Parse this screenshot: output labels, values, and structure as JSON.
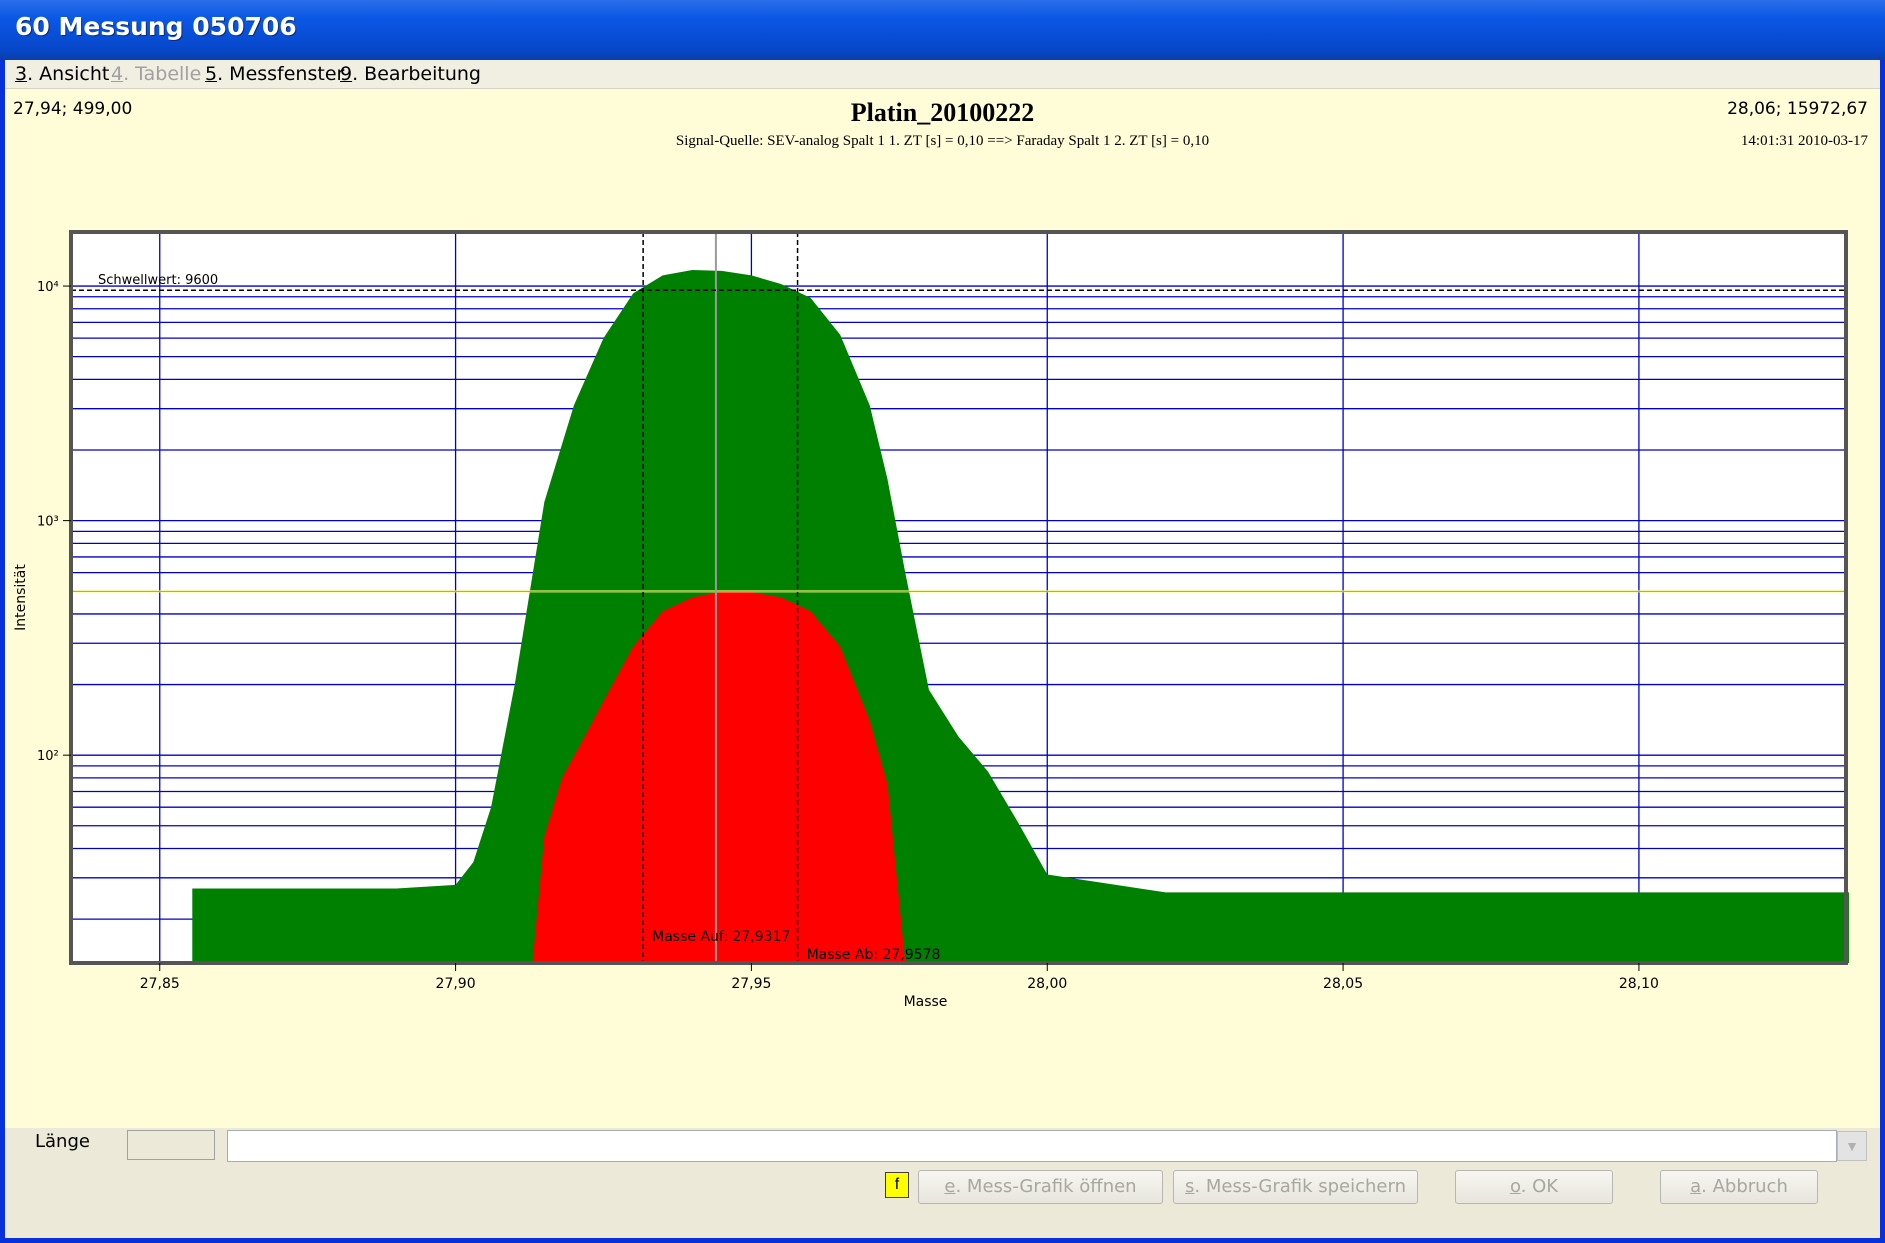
{
  "window": {
    "title": "60  Messung 050706"
  },
  "menu": [
    {
      "key": "3",
      "label": ". Ansicht",
      "disabled": false
    },
    {
      "key": "4",
      "label": ". Tabelle",
      "disabled": true
    },
    {
      "key": "5",
      "label": ". Messfenster",
      "disabled": false
    },
    {
      "key": "9",
      "label": ". Bearbeitung",
      "disabled": false
    }
  ],
  "cursor_left": "27,94; 499,00",
  "cursor_right": "28,06; 15972,67",
  "timestamp": "14:01:31 2010-03-17",
  "chart_data": {
    "type": "area",
    "title": "Platin_20100222",
    "subtitle": "Signal-Quelle: SEV-analog Spalt 1  1. ZT [s] = 0,10  ==>  Faraday Spalt 1  2. ZT [s] = 0,10",
    "xlabel": "Masse",
    "ylabel": "Intensität",
    "y_scale": "log",
    "xlim": [
      27.835,
      28.135
    ],
    "ylim": [
      13,
      17000
    ],
    "x_ticks": [
      "27,85",
      "27,90",
      "27,95",
      "28,00",
      "28,05",
      "28,10"
    ],
    "x_tick_values": [
      27.85,
      27.9,
      27.95,
      28.0,
      28.05,
      28.1
    ],
    "y_ticks": [
      "10⁴",
      "10³",
      "10²"
    ],
    "y_tick_values": [
      10000,
      1000,
      100
    ],
    "grid": true,
    "colors": {
      "green": "#008000",
      "red": "#ff0000",
      "grid": "#0000cc",
      "yellow_line": "#ffff66",
      "cursor": "#9a9a9a"
    },
    "series": [
      {
        "color": "green",
        "x": [
          27.8555,
          27.87,
          27.89,
          27.9,
          27.903,
          27.906,
          27.91,
          27.915,
          27.92,
          27.925,
          27.93,
          27.935,
          27.94,
          27.945,
          27.95,
          27.955,
          27.96,
          27.965,
          27.97,
          27.973,
          27.976,
          27.98,
          27.985,
          27.99,
          27.995,
          28.0,
          28.02,
          28.05,
          28.08,
          28.11,
          28.1355
        ],
        "y": [
          27,
          27,
          27,
          28,
          35,
          60,
          200,
          1200,
          3100,
          6000,
          9300,
          11100,
          11700,
          11600,
          11100,
          10200,
          8900,
          6200,
          3100,
          1500,
          600,
          190,
          120,
          85,
          52,
          31,
          26,
          26,
          26,
          26,
          26
        ]
      },
      {
        "color": "red",
        "x": [
          27.913,
          27.915,
          27.918,
          27.921,
          27.925,
          27.93,
          27.935,
          27.94,
          27.945,
          27.95,
          27.955,
          27.96,
          27.965,
          27.97,
          27.973,
          27.976
        ],
        "y": [
          13,
          45,
          80,
          110,
          170,
          290,
          410,
          470,
          499,
          495,
          470,
          410,
          290,
          140,
          75,
          13
        ]
      }
    ],
    "threshold": {
      "label": "Schwellwert: 9600",
      "value": 9600
    },
    "horizontal_marker": 499,
    "cursor_x": 27.944,
    "masse_auf": {
      "label": "Masse Auf: 27,9317",
      "value": 27.9317
    },
    "masse_ab": {
      "label": "Masse Ab: 27,9578",
      "value": 27.9578
    }
  },
  "bottom": {
    "laenge_label": "Länge",
    "f_label": "f",
    "buttons": [
      {
        "key": "e",
        "label": ". Mess-Grafik öffnen"
      },
      {
        "key": "s",
        "label": ". Mess-Grafik speichern"
      },
      {
        "key": "o",
        "label": ". OK"
      },
      {
        "key": "a",
        "label": ". Abbruch"
      }
    ]
  }
}
